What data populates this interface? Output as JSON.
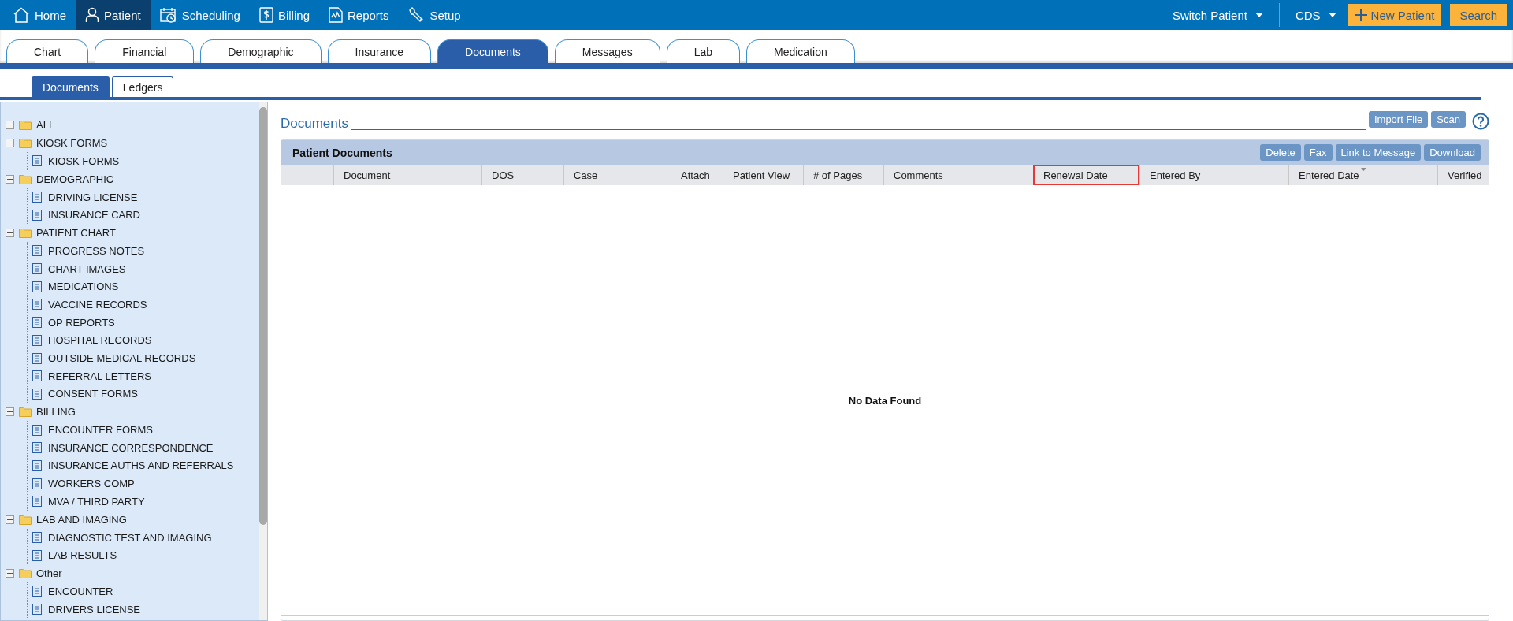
{
  "nav": {
    "items": [
      {
        "label": "Home",
        "selected": false
      },
      {
        "label": "Patient",
        "selected": true
      },
      {
        "label": "Scheduling",
        "selected": false
      },
      {
        "label": "Billing",
        "selected": false
      },
      {
        "label": "Reports",
        "selected": false
      },
      {
        "label": "Setup",
        "selected": false
      }
    ],
    "switch_patient": "Switch Patient",
    "cds": "CDS",
    "new_patient": "New Patient",
    "search": "Search"
  },
  "tabs": [
    {
      "label": "Chart",
      "selected": false
    },
    {
      "label": "Financial",
      "selected": false
    },
    {
      "label": "Demographic",
      "selected": false
    },
    {
      "label": "Insurance",
      "selected": false
    },
    {
      "label": "Documents",
      "selected": true
    },
    {
      "label": "Messages",
      "selected": false
    },
    {
      "label": "Lab",
      "selected": false
    },
    {
      "label": "Medication",
      "selected": false
    }
  ],
  "subtabs": [
    {
      "label": "Documents",
      "selected": true
    },
    {
      "label": "Ledgers",
      "selected": false
    }
  ],
  "tree": [
    {
      "label": "ALL",
      "expanded": true
    },
    {
      "label": "KIOSK FORMS",
      "expanded": true,
      "children": [
        {
          "label": "KIOSK FORMS"
        }
      ]
    },
    {
      "label": "DEMOGRAPHIC",
      "expanded": true,
      "children": [
        {
          "label": "DRIVING LICENSE"
        },
        {
          "label": "INSURANCE CARD"
        }
      ]
    },
    {
      "label": "PATIENT CHART",
      "expanded": true,
      "children": [
        {
          "label": "PROGRESS NOTES"
        },
        {
          "label": "CHART IMAGES"
        },
        {
          "label": "MEDICATIONS"
        },
        {
          "label": "VACCINE RECORDS"
        },
        {
          "label": "OP REPORTS"
        },
        {
          "label": "HOSPITAL RECORDS"
        },
        {
          "label": "OUTSIDE MEDICAL RECORDS"
        },
        {
          "label": "REFERRAL LETTERS"
        },
        {
          "label": "CONSENT FORMS"
        }
      ]
    },
    {
      "label": "BILLING",
      "expanded": true,
      "children": [
        {
          "label": "ENCOUNTER FORMS"
        },
        {
          "label": "INSURANCE CORRESPONDENCE"
        },
        {
          "label": "INSURANCE AUTHS AND REFERRALS"
        },
        {
          "label": "WORKERS COMP"
        },
        {
          "label": "MVA / THIRD PARTY"
        }
      ]
    },
    {
      "label": "LAB AND IMAGING",
      "expanded": true,
      "children": [
        {
          "label": "DIAGNOSTIC TEST AND IMAGING"
        },
        {
          "label": "LAB RESULTS"
        }
      ]
    },
    {
      "label": "Other",
      "expanded": true,
      "children": [
        {
          "label": "ENCOUNTER"
        },
        {
          "label": "DRIVERS LICENSE"
        }
      ]
    }
  ],
  "documents": {
    "title": "Documents",
    "buttons": [
      "Import File",
      "Scan"
    ]
  },
  "table": {
    "title": "Patient Documents",
    "buttons": [
      "Delete",
      "Fax",
      "Link to Message",
      "Download"
    ],
    "columns": [
      {
        "label": "Document",
        "highlighted": false,
        "sorted": false
      },
      {
        "label": "DOS",
        "highlighted": false,
        "sorted": false
      },
      {
        "label": "Case",
        "highlighted": false,
        "sorted": false
      },
      {
        "label": "Attach",
        "highlighted": false,
        "sorted": false
      },
      {
        "label": "Patient View",
        "highlighted": false,
        "sorted": false
      },
      {
        "label": "# of Pages",
        "highlighted": false,
        "sorted": false
      },
      {
        "label": "Comments",
        "highlighted": false,
        "sorted": false
      },
      {
        "label": "Renewal Date",
        "highlighted": true,
        "sorted": false
      },
      {
        "label": "Entered By",
        "highlighted": false,
        "sorted": false
      },
      {
        "label": "Entered Date",
        "highlighted": false,
        "sorted": true
      },
      {
        "label": "Verified",
        "highlighted": false,
        "sorted": false
      }
    ],
    "empty_message": "No Data Found"
  }
}
